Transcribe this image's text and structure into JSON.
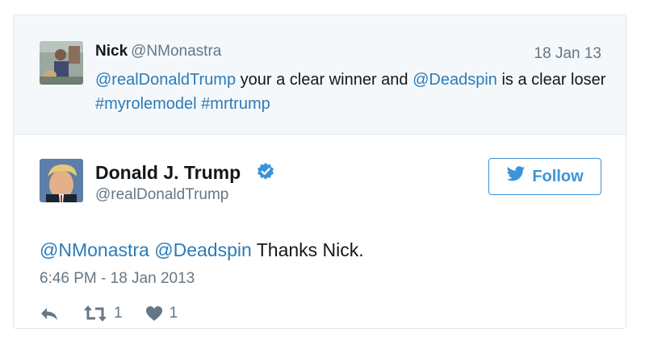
{
  "reply_context": {
    "user_name": "Nick",
    "user_handle": "@NMonastra",
    "date": "18 Jan 13",
    "text": {
      "mention1": "@realDonaldTrump",
      "plain1": " your a clear winner and ",
      "mention2": "@Deadspin",
      "plain2": " is a clear loser ",
      "hashtag1": "#myrolemodel",
      "space": " ",
      "hashtag2": "#mrtrump"
    }
  },
  "tweet": {
    "user_name": "Donald J. Trump",
    "user_handle": "@realDonaldTrump",
    "verified": true,
    "text": {
      "mention1": "@NMonastra",
      "space": " ",
      "mention2": "@Deadspin",
      "plain": " Thanks Nick."
    },
    "timestamp": "6:46 PM - 18 Jan 2013",
    "retweet_count": "1",
    "like_count": "1"
  },
  "follow_button": {
    "label": "Follow"
  },
  "icons": {
    "verified_badge": "verified-badge-icon",
    "bird": "twitter-bird-icon",
    "reply": "reply-icon",
    "retweet": "retweet-icon",
    "like": "heart-icon"
  },
  "colors": {
    "link": "#2b7bb9",
    "follow_accent": "#3b94d9",
    "verified": "#3b94d9",
    "muted": "#657786",
    "context_background": "#f5f8fa",
    "border": "#e1e8ed"
  }
}
